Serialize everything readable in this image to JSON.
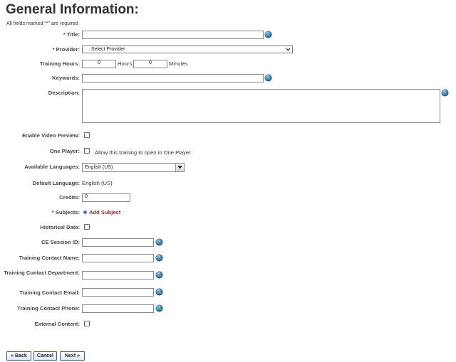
{
  "page": {
    "title": "General Information:",
    "required_note": "All fields marked \"*\" are required"
  },
  "form": {
    "title_label": "* Title:",
    "provider_label": "* Provider:",
    "provider_selected": "Select Provider",
    "training_hours_label": "Training Hours:",
    "hours_value": "0",
    "hours_unit": "Hours",
    "minutes_value": "0",
    "minutes_unit": "Minutes",
    "keywords_label": "Keywords:",
    "description_label": "Description:",
    "video_preview_label": "Enable Video Preview:",
    "one_player_label": "One Player:",
    "one_player_text": "Allow this training to open in One Player",
    "languages_label": "Available Languages:",
    "languages_selected": "English (US)",
    "default_language_label": "Default Language:",
    "default_language_value": "English (US)",
    "credits_label": "Credits:",
    "credits_value": "0",
    "subjects_label": "* Subjects:",
    "add_subject": "Add Subject",
    "historical_label": "Historical Data:",
    "ce_session_label": "CE Session ID:",
    "contact_name_label": "Training Contact Name:",
    "contact_department_label": "Training Contact Department:",
    "contact_email_label": "Training Contact Email:",
    "contact_phone_label": "Training Contact Phone:",
    "external_label": "External Content:"
  },
  "buttons": {
    "back": "« Back",
    "cancel": "Cancel",
    "next": "Next »"
  },
  "colors": {
    "accent_link": "#b3262a",
    "button_border": "#3c5a8c"
  },
  "icons": {
    "lookup": "globe-lookup-icon",
    "dropdown": "chevron-down-icon",
    "add": "add-dot-icon"
  }
}
